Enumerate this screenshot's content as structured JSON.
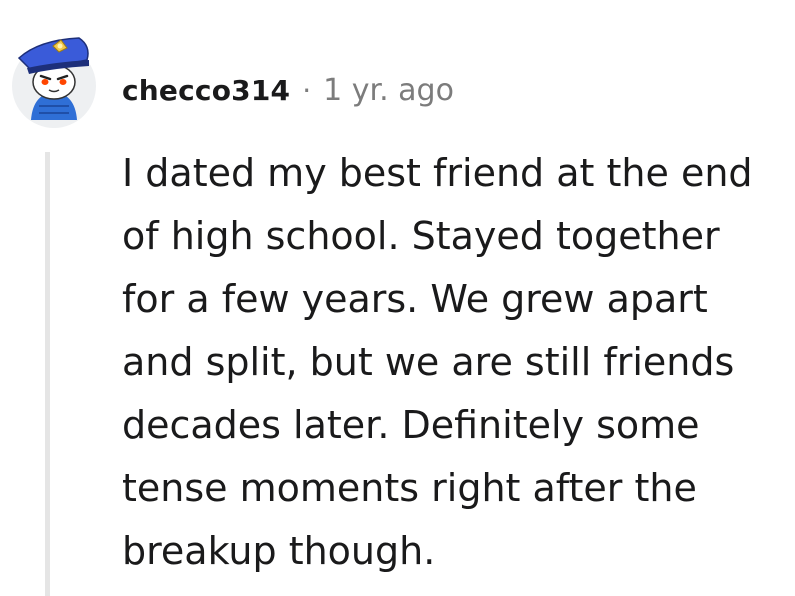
{
  "comment": {
    "author": "checco314",
    "separator": "·",
    "timestamp": "1 yr. ago",
    "avatar_icon": "snoo-captain-avatar-icon",
    "body_lines": [
      "I dated my best friend at the end",
      "of high school. Stayed together",
      "for a few years. We grew apart",
      "and split, but we are still friends",
      "decades later. Definitely some",
      "tense moments right after the",
      "breakup though."
    ]
  },
  "colors": {
    "text": "#1a1a1b",
    "meta": "#7c7c7c",
    "thread_line": "#e5e5e5",
    "avatar_hat": "#3a5bd9",
    "avatar_jacket": "#2f6fd6"
  }
}
